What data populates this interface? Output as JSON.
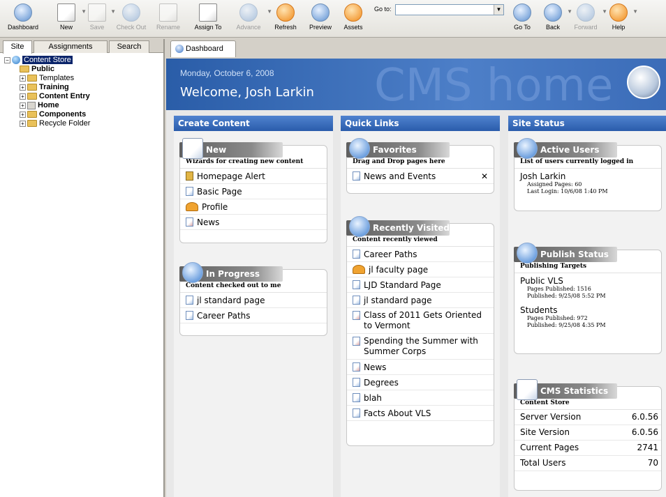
{
  "toolbar": {
    "buttons": [
      {
        "label": "Dashboard",
        "icon": "dashboard-icon",
        "enabled": true
      },
      {
        "label": "New",
        "icon": "new-icon",
        "enabled": true
      },
      {
        "label": "Save",
        "icon": "save-icon",
        "enabled": false
      },
      {
        "label": "Check Out",
        "icon": "check-out-icon",
        "enabled": false
      },
      {
        "label": "Rename",
        "icon": "rename-icon",
        "enabled": false
      },
      {
        "label": "Assign To",
        "icon": "assign-to-icon",
        "enabled": true
      },
      {
        "label": "Advance",
        "icon": "advance-icon",
        "enabled": false
      },
      {
        "label": "Refresh",
        "icon": "refresh-icon",
        "enabled": true
      },
      {
        "label": "Preview",
        "icon": "preview-icon",
        "enabled": true
      },
      {
        "label": "Assets",
        "icon": "assets-icon",
        "enabled": true
      },
      {
        "label": "Go To",
        "icon": "go-to-icon",
        "enabled": true
      },
      {
        "label": "Back",
        "icon": "back-icon",
        "enabled": true
      },
      {
        "label": "Forward",
        "icon": "forward-icon",
        "enabled": false
      },
      {
        "label": "Help",
        "icon": "help-icon",
        "enabled": true
      }
    ],
    "goto_label": "Go to:",
    "goto_value": ""
  },
  "left_tabs": [
    "Site",
    "Assignments",
    "Search"
  ],
  "tree": {
    "root": "Content Store",
    "children": [
      {
        "label": "Public",
        "bold": true
      },
      {
        "label": "Templates",
        "bold": false
      },
      {
        "label": "Training",
        "bold": true
      },
      {
        "label": "Content Entry",
        "bold": true
      },
      {
        "label": "Home",
        "bold": true
      },
      {
        "label": "Components",
        "bold": true
      },
      {
        "label": "Recycle Folder",
        "bold": false
      }
    ]
  },
  "right_tab": "Dashboard",
  "banner": {
    "date": "Monday, October 6, 2008",
    "welcome": "Welcome, Josh Larkin",
    "watermark": "CMS home"
  },
  "create_content": {
    "header": "Create Content",
    "new_box": {
      "title": "New",
      "subtitle": "Wizards for creating new content",
      "items": [
        "Homepage Alert",
        "Basic Page",
        "Profile",
        "News"
      ]
    },
    "progress_box": {
      "title": "In Progress",
      "subtitle": "Content checked out to me",
      "items": [
        "jl standard page",
        "Career Paths"
      ]
    }
  },
  "quick_links": {
    "header": "Quick Links",
    "favorites": {
      "title": "Favorites",
      "subtitle": "Drag and Drop pages here",
      "items": [
        "News and Events"
      ],
      "remove_glyph": "✕"
    },
    "recent": {
      "title": "Recently Visited",
      "subtitle": "Content recently viewed",
      "items": [
        "Career Paths",
        "jl faculty page",
        "LJD Standard Page",
        "jl standard page",
        "Class of 2011 Gets Oriented to Vermont",
        "Spending the Summer with Summer Corps",
        "News",
        "Degrees",
        "blah",
        "Facts About VLS"
      ]
    }
  },
  "site_status": {
    "header": "Site Status",
    "active_users": {
      "title": "Active Users",
      "subtitle": "List of users currently logged in",
      "name": "Josh Larkin",
      "assigned": "Assigned Pages: 60",
      "last_login": "Last Login: 10/6/08 1:40 PM"
    },
    "publish": {
      "title": "Publish Status",
      "subtitle": "Publishing Targets",
      "targets": [
        {
          "name": "Public VLS",
          "pages": "Pages Published: 1516",
          "published": "Published: 9/25/08 5:52 PM"
        },
        {
          "name": "Students",
          "pages": "Pages Published: 972",
          "published": "Published: 9/25/08 4:35 PM"
        }
      ]
    },
    "stats": {
      "title": "CMS Statistics",
      "subtitle": "Content Store",
      "rows": [
        {
          "label": "Server Version",
          "value": "6.0.56"
        },
        {
          "label": "Site Version",
          "value": "6.0.56"
        },
        {
          "label": "Current Pages",
          "value": "2741"
        },
        {
          "label": "Total Users",
          "value": "70"
        }
      ]
    }
  }
}
